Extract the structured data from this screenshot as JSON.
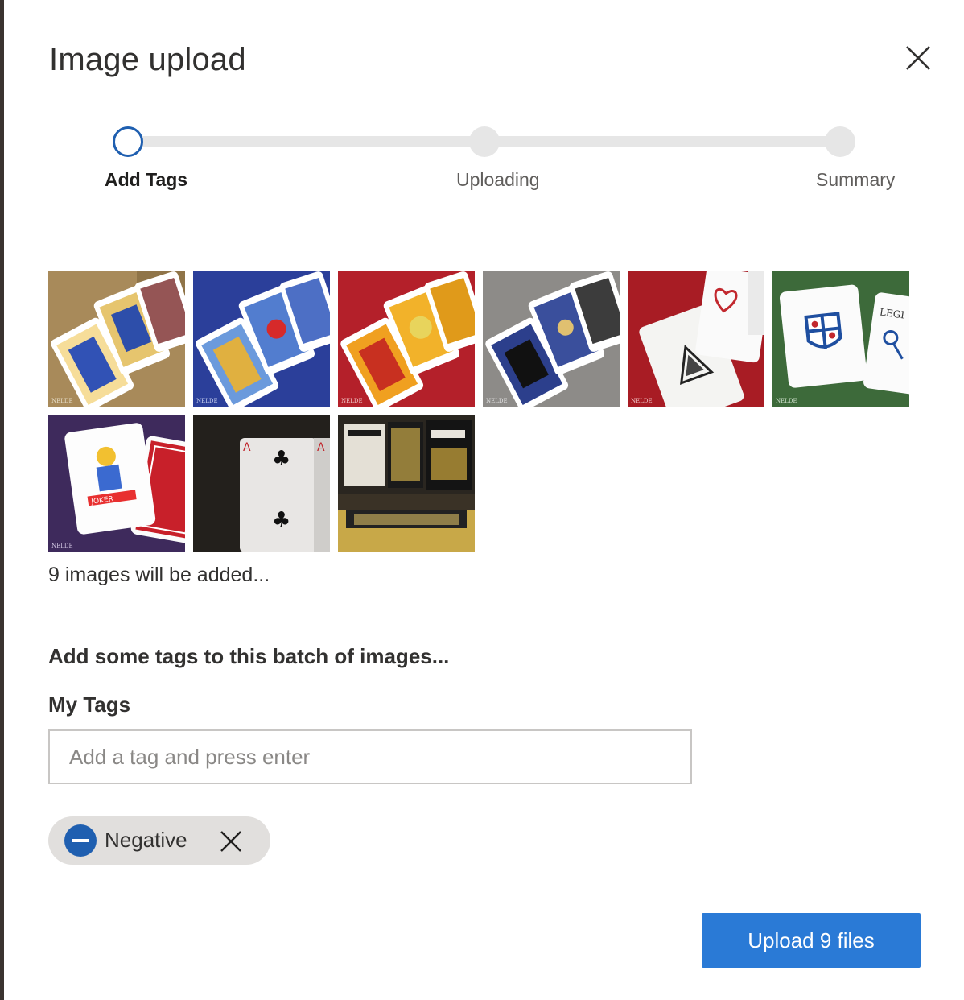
{
  "dialog": {
    "title": "Image upload",
    "close_icon": "close-icon"
  },
  "stepper": {
    "steps": [
      {
        "label": "Add Tags",
        "state": "active"
      },
      {
        "label": "Uploading",
        "state": "pending"
      },
      {
        "label": "Summary",
        "state": "pending"
      }
    ]
  },
  "thumbnails": [
    {
      "name": "playing cards jack queen king on tan felt",
      "background": "#a88a5a"
    },
    {
      "name": "playing cards jack queen king on blue felt",
      "background": "#2b3f9a"
    },
    {
      "name": "playing cards jack queen king on red felt",
      "background": "#b4202a"
    },
    {
      "name": "playing cards jack queen king on gray felt",
      "background": "#8d8b88"
    },
    {
      "name": "aces on red felt",
      "background": "#a81c24"
    },
    {
      "name": "cards on green felt",
      "background": "#3d6a3a"
    },
    {
      "name": "joker card on purple felt",
      "background": "#3e2a5c"
    },
    {
      "name": "ace of clubs on dark background",
      "background": "#1f1d19"
    },
    {
      "name": "black and gold card decks",
      "background": "#2a2620"
    }
  ],
  "summary_text": "9 images will be added...",
  "tags_section": {
    "prompt": "Add some tags to this batch of images...",
    "label": "My Tags",
    "input_placeholder": "Add a tag and press enter",
    "input_value": ""
  },
  "chips": [
    {
      "label": "Negative",
      "icon": "minus-circle-icon",
      "remove_icon": "close-icon"
    }
  ],
  "actions": {
    "upload_label": "Upload 9 files"
  },
  "colors": {
    "accent": "#2a7ad6",
    "step_active": "#1f5fb0",
    "chip_background": "#e1dfdd"
  }
}
